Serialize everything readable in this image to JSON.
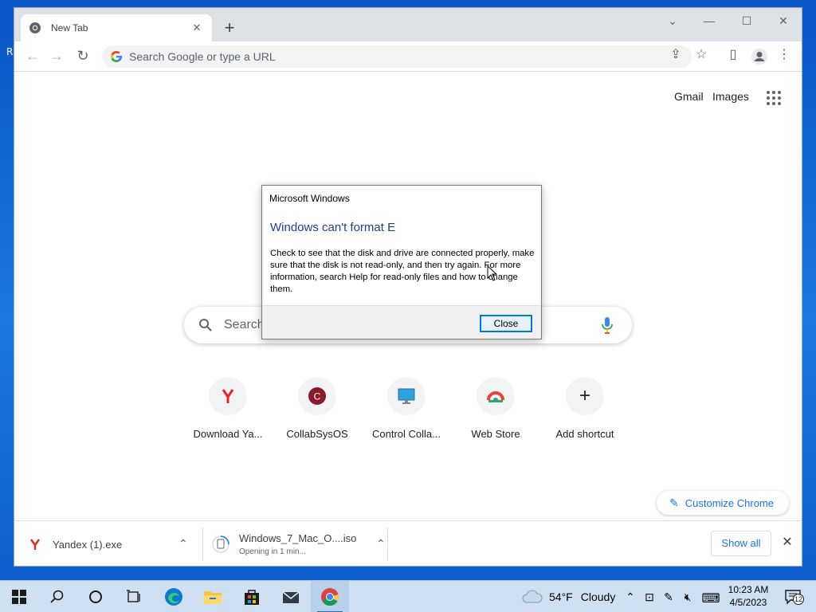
{
  "browser": {
    "tab": {
      "title": "New Tab",
      "close_glyph": "✕",
      "icon": "chrome-icon"
    },
    "new_tab_glyph": "+",
    "window_controls": {
      "dropdown": "⌄",
      "minimize": "—",
      "maximize": "☐",
      "close": "✕"
    },
    "toolbar": {
      "back_glyph": "←",
      "forward_glyph": "→",
      "reload_glyph": "↻",
      "omnibox_placeholder": "Search Google or type a URL",
      "share_glyph": "⇪",
      "bookmark_glyph": "☆",
      "sidepanel_glyph": "▯",
      "menu_glyph": "⋮"
    }
  },
  "ntp": {
    "links": {
      "gmail": "Gmail",
      "images": "Images"
    },
    "search_placeholder": "Search",
    "shortcuts": [
      {
        "label": "Download Ya...",
        "icon": "yandex-icon"
      },
      {
        "label": "CollabSysOS",
        "icon": "collab-c-icon"
      },
      {
        "label": "Control Colla...",
        "icon": "monitor-icon"
      },
      {
        "label": "Web Store",
        "icon": "webstore-icon"
      },
      {
        "label": "Add shortcut",
        "icon": "plus-icon"
      }
    ],
    "add_glyph": "+",
    "customize_label": "Customize Chrome",
    "customize_glyph": "✎"
  },
  "downloads": {
    "items": [
      {
        "name": "Yandex (1).exe",
        "status": ""
      },
      {
        "name": "Windows_7_Mac_O....iso",
        "status": "Opening in 1 min..."
      }
    ],
    "chevron_glyph": "⌃",
    "show_all_label": "Show all",
    "close_glyph": "✕"
  },
  "dialog": {
    "window_title": "Microsoft Windows",
    "heading": "Windows can't format E",
    "body": "Check to see that the disk and drive are connected properly, make sure that the disk is not read-only, and then try again. For more information, search Help for read-only files and how to change them.",
    "close_label": "Close"
  },
  "taskbar": {
    "weather": {
      "temp": "54°F",
      "condition": "Cloudy"
    },
    "tray": {
      "chevron": "⌃",
      "network": "⊡",
      "pen": "✎",
      "volume": "🔇︎",
      "keyboard": "⌨"
    },
    "clock": {
      "time": "10:23 AM",
      "date": "4/5/2023"
    },
    "notification_count": "12"
  },
  "colors": {
    "chrome_accent": "#1a73e8",
    "dialog_heading": "#1f3e8c",
    "taskbar_bg": "#cfe0f3"
  }
}
